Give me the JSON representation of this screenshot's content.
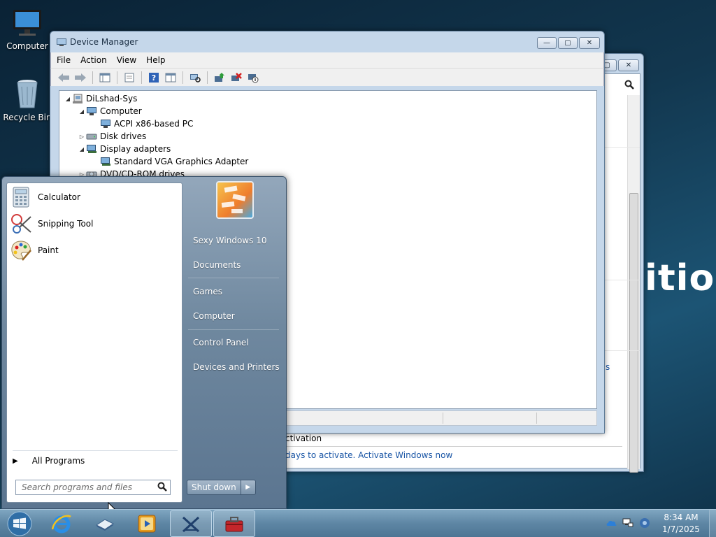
{
  "desktop": {
    "icons": [
      {
        "label": "Computer",
        "icon": "monitor-icon"
      },
      {
        "label": "Recycle Bin",
        "icon": "recycle-bin-icon"
      }
    ],
    "bg_text": "itior"
  },
  "back_window": {
    "activation_heading": "ctivation",
    "activation_text": "days to activate. Activate Windows now",
    "link_fragment": "s"
  },
  "device_manager": {
    "title": "Device Manager",
    "menu": [
      "File",
      "Action",
      "View",
      "Help"
    ],
    "tree": [
      {
        "label": "DiLshad-Sys",
        "level": 0,
        "expanded": true,
        "icon": "computer-icon"
      },
      {
        "label": "Computer",
        "level": 1,
        "expanded": true,
        "icon": "monitor-icon"
      },
      {
        "label": "ACPI x86-based PC",
        "level": 2,
        "icon": "monitor-icon"
      },
      {
        "label": "Disk drives",
        "level": 1,
        "expanded": false,
        "icon": "disk-drive-icon"
      },
      {
        "label": "Display adapters",
        "level": 1,
        "expanded": true,
        "icon": "display-adapter-icon"
      },
      {
        "label": "Standard VGA Graphics Adapter",
        "level": 2,
        "icon": "display-adapter-icon"
      },
      {
        "label": "DVD/CD-ROM drives",
        "level": 1,
        "expanded": false,
        "icon": "dvd-drive-icon"
      }
    ]
  },
  "start_menu": {
    "programs": [
      {
        "label": "Calculator",
        "icon": "calculator-icon"
      },
      {
        "label": "Snipping Tool",
        "icon": "scissors-icon"
      },
      {
        "label": "Paint",
        "icon": "paint-palette-icon"
      }
    ],
    "all_programs": "All Programs",
    "search_placeholder": "Search programs and files",
    "right_items": [
      "Sexy Windows 10",
      "Documents",
      "Games",
      "Computer",
      "Control Panel",
      "Devices and Printers"
    ],
    "shutdown_label": "Shut down"
  },
  "taskbar": {
    "apps": [
      "internet-explorer-icon",
      "device-icon",
      "media-player-icon",
      "tools-icon",
      "toolbox-icon"
    ],
    "time": "8:34 AM",
    "date": "1/7/2025"
  }
}
